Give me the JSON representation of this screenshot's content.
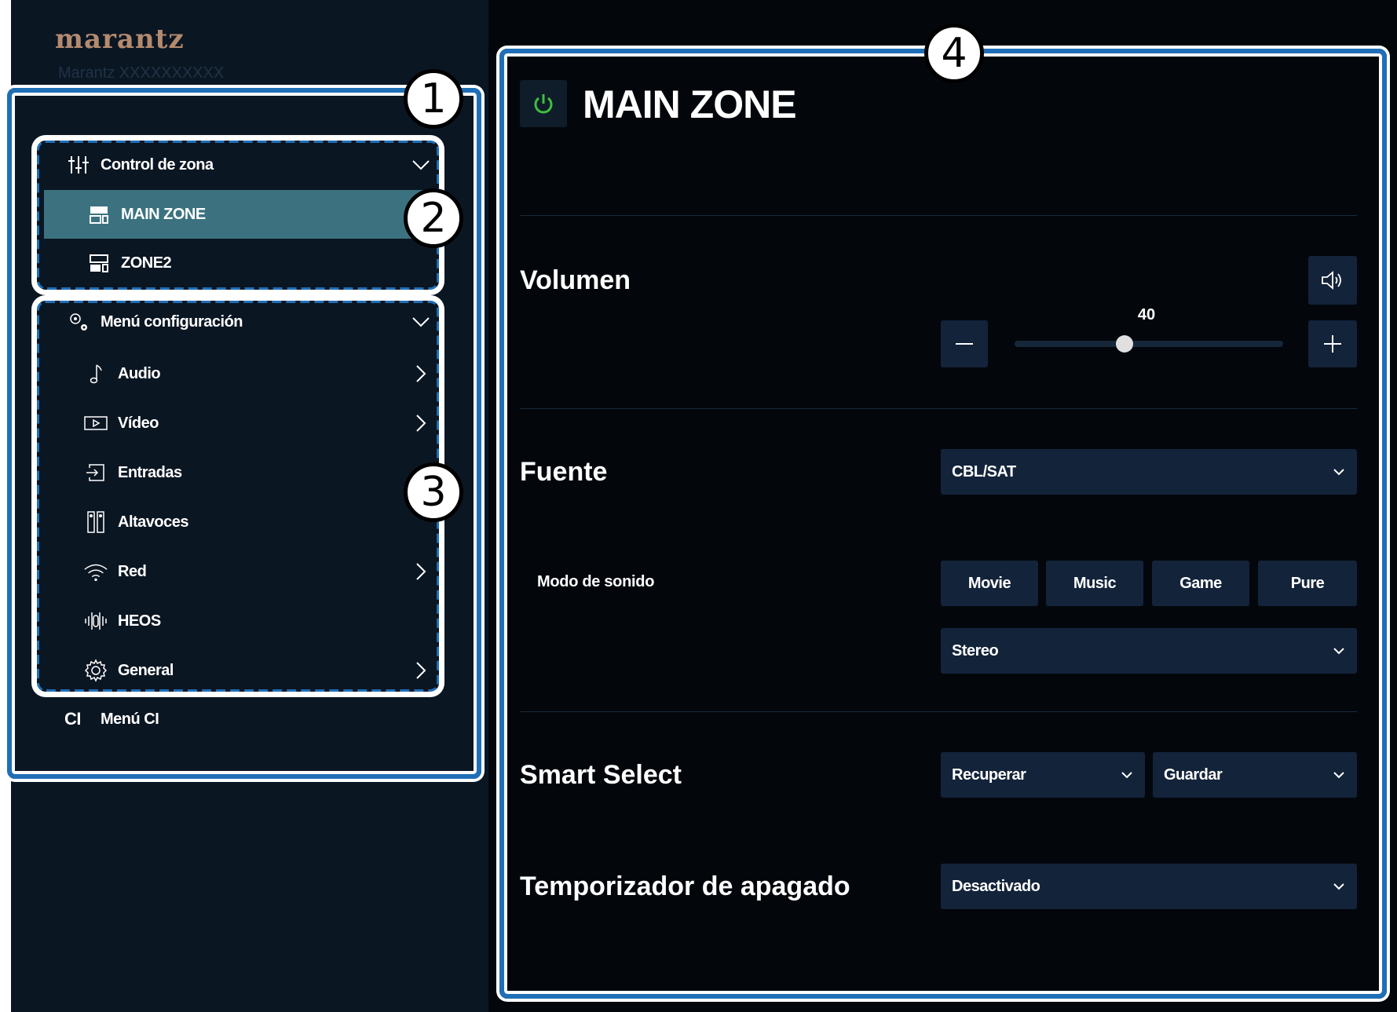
{
  "brand": {
    "logo": "marantz",
    "model": "Marantz XXXXXXXXXX"
  },
  "annotations": [
    "1",
    "2",
    "3",
    "4"
  ],
  "sidebar": {
    "zone_control": {
      "label": "Control de zona",
      "icon": "sliders-icon",
      "items": [
        {
          "label": "MAIN ZONE",
          "icon": "main-zone-icon",
          "selected": true
        },
        {
          "label": "ZONE2",
          "icon": "zone2-icon",
          "selected": false
        }
      ]
    },
    "setup_menu": {
      "label": "Menú configuración",
      "icon": "gears-icon",
      "items": [
        {
          "label": "Audio",
          "icon": "music-note-icon"
        },
        {
          "label": "Vídeo",
          "icon": "video-icon"
        },
        {
          "label": "Entradas",
          "icon": "input-icon"
        },
        {
          "label": "Altavoces",
          "icon": "speakers-icon"
        },
        {
          "label": "Red",
          "icon": "wifi-icon"
        },
        {
          "label": "HEOS",
          "icon": "heos-icon"
        },
        {
          "label": "General",
          "icon": "gear-icon"
        }
      ]
    },
    "ci_menu": {
      "abbr": "CI",
      "label": "Menú CI"
    }
  },
  "main": {
    "title": "MAIN ZONE",
    "power_icon": "power-icon",
    "volume": {
      "label": "Volumen",
      "value": "40",
      "level": 40,
      "min": 0,
      "max": 98
    },
    "source": {
      "label": "Fuente",
      "value": "CBL/SAT"
    },
    "sound_mode": {
      "label": "Modo de sonido",
      "buttons": [
        "Movie",
        "Music",
        "Game",
        "Pure"
      ],
      "value": "Stereo"
    },
    "smart_select": {
      "label": "Smart Select",
      "recall": "Recuperar",
      "save": "Guardar"
    },
    "sleep_timer": {
      "label": "Temporizador de apagado",
      "value": "Desactivado"
    },
    "colors": {
      "accent": "#3c7280",
      "power": "#3fbf3f",
      "panel": "#13233a",
      "frame": "#1f6fb7"
    }
  }
}
